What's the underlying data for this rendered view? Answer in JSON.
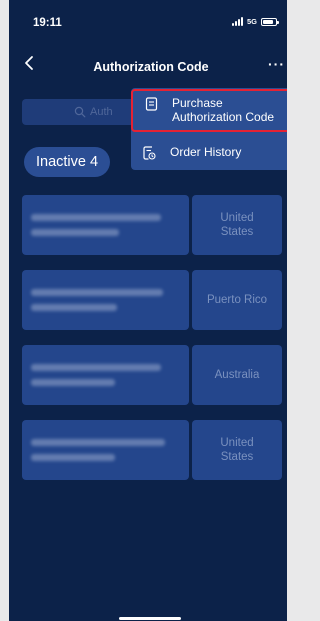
{
  "status_bar": {
    "time": "19:11",
    "network": "5G"
  },
  "header": {
    "title": "Authorization Code"
  },
  "search": {
    "placeholder": "Auth"
  },
  "filter": {
    "label": "Inactive 4"
  },
  "menu": {
    "items": [
      {
        "label": "Purchase\nAuthorization Code"
      },
      {
        "label": "Order History"
      }
    ]
  },
  "devices": [
    {
      "country": "United\nStates"
    },
    {
      "country": "Puerto Rico"
    },
    {
      "country": "Australia"
    },
    {
      "country": "United\nStates"
    }
  ],
  "colors": {
    "background": "#0c2249",
    "card": "#24468c",
    "menu": "#2b4e93",
    "highlight_border": "#e52234"
  }
}
